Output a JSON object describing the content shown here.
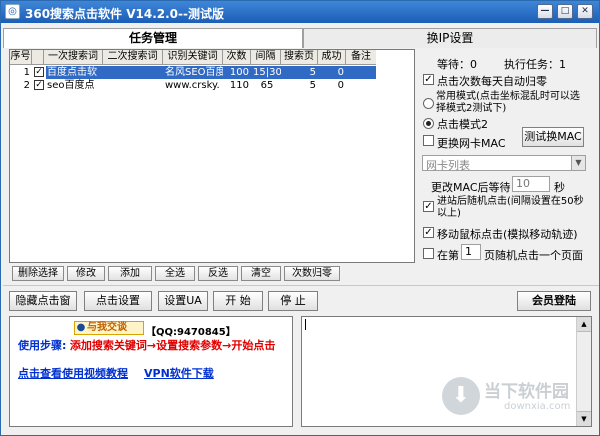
{
  "window": {
    "title": "360搜索点击软件 V14.2.0--测试版"
  },
  "tabs": [
    "任务管理",
    "换IP设置"
  ],
  "table": {
    "headers": [
      "序号",
      "一次搜索词",
      "二次搜索词",
      "识别关键词",
      "次数",
      "间隔",
      "搜索页",
      "成功",
      "备注"
    ],
    "rows": [
      {
        "no": "1",
        "checked": "✓",
        "kw1": "百度点击软",
        "kw2": "",
        "ident": "名风SEO百度",
        "count": "100",
        "interval": "15|30",
        "page": "5",
        "success": "0",
        "note": ""
      },
      {
        "no": "2",
        "checked": "✓",
        "kw1": "seo百度点",
        "kw2": "",
        "ident": "www.crsky.",
        "count": "110",
        "interval": "65",
        "page": "5",
        "success": "0",
        "note": ""
      }
    ]
  },
  "list_buttons": [
    "删除选择",
    "修改",
    "添加",
    "全选",
    "反选",
    "清空",
    "次数归零"
  ],
  "right": {
    "waiting_label": "等待：0",
    "running_label": "执行任务：1",
    "opt_reset_daily": "点击次数每天自动归零",
    "opt_normal_mode": "常用模式(点击坐标混乱时可以选择模式2测试下)",
    "opt_mode2": "点击模式2",
    "opt_change_mac": "更换网卡MAC",
    "test_mac_btn": "测试换MAC",
    "nic_list": "网卡列表",
    "mac_wait_label": "更改MAC后等待：",
    "mac_wait_value": "10",
    "mac_wait_unit": "秒",
    "opt_random_click": "进站后随机点击(间隔设置在50秒以上)",
    "opt_move_mouse": "移动鼠标点击(模拟移动轨迹)",
    "opt_page_prefix": "在第",
    "opt_page_value": "1",
    "opt_page_suffix": "页随机点击一个页面"
  },
  "actions": [
    "隐藏点击窗",
    "点击设置",
    "设置UA",
    "开 始",
    "停 止"
  ],
  "login_btn": "会员登陆",
  "info": {
    "chat_badge": "与我交谈",
    "qq": "【QQ:9470845】",
    "steps_label": "使用步骤:",
    "steps_text": "添加搜索关键词→设置搜索参数→开始点击",
    "video_link": "点击查看使用视频教程",
    "vpn_link": "VPN软件下载"
  },
  "watermark": {
    "name": "当下软件园",
    "url": "downxia.com"
  },
  "colors": {
    "title_bar": "#2a6ab8",
    "selected_row": "#316ac5",
    "accent_red": "#e00000",
    "link_blue": "#0030d0"
  }
}
